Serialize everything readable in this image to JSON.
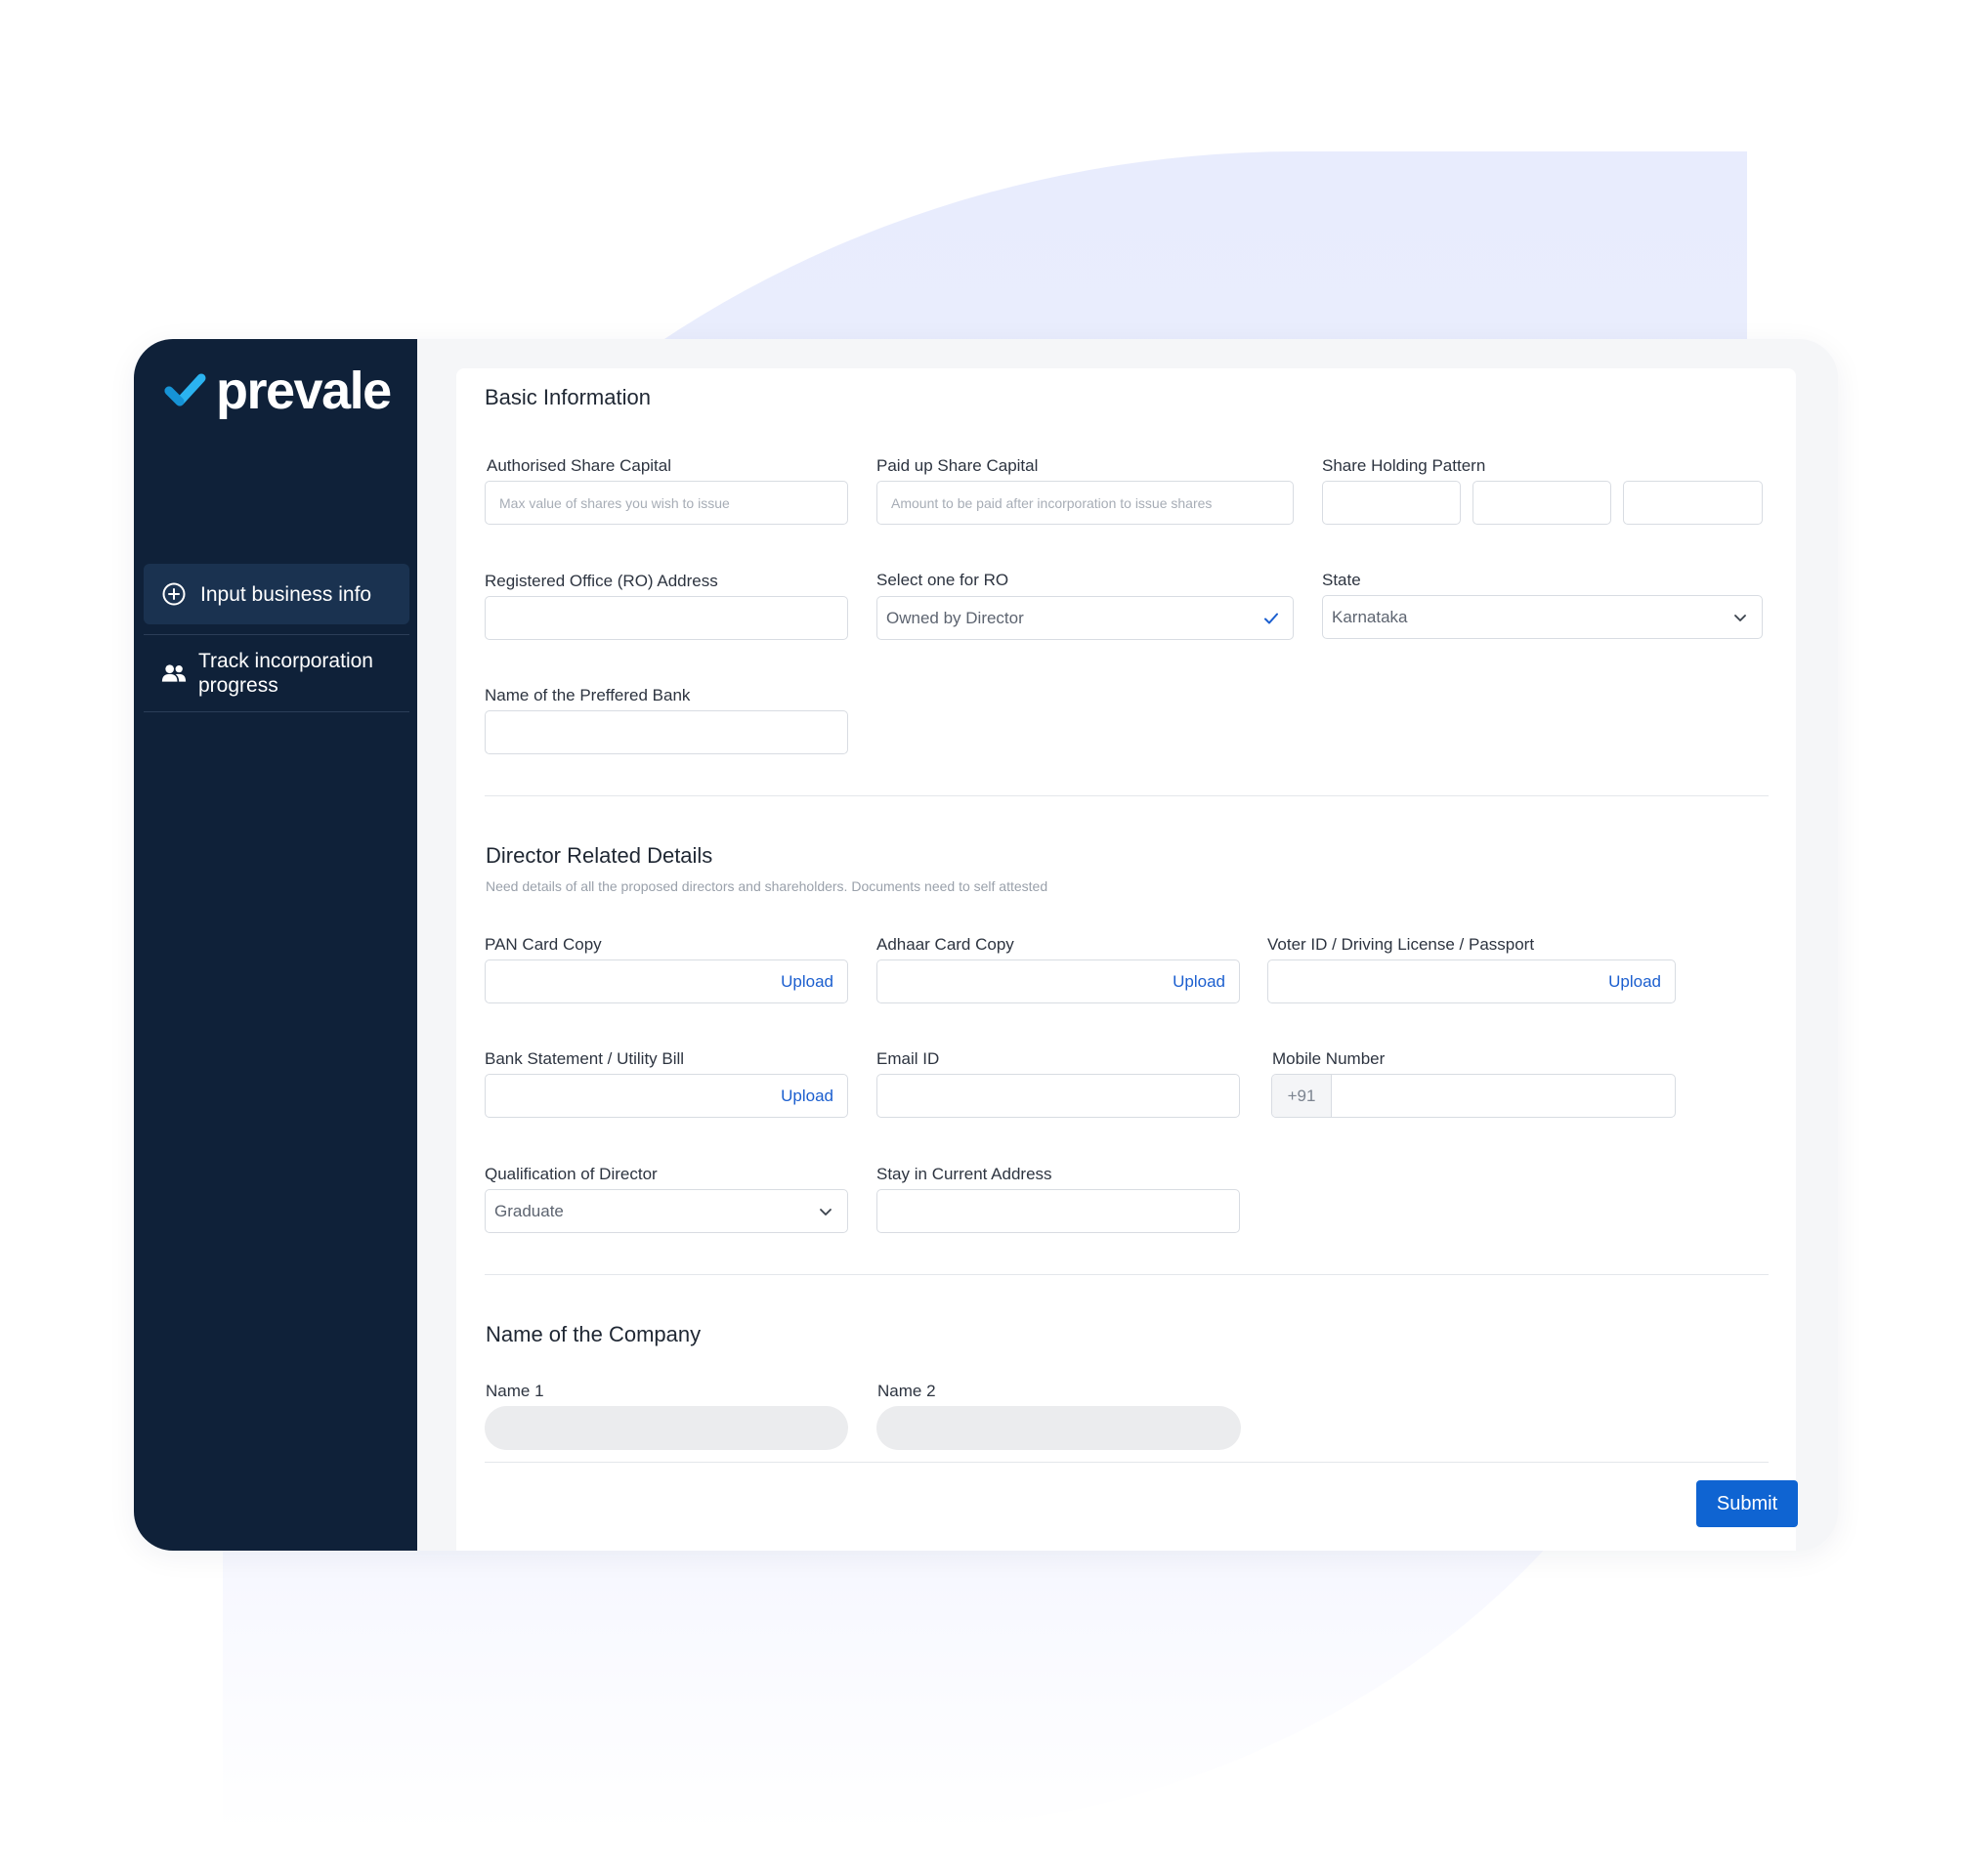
{
  "brand": {
    "name": "prevale"
  },
  "sidebar": {
    "items": [
      {
        "label": "Input business info",
        "icon": "plus-circle-icon",
        "active": true
      },
      {
        "label": "Track incorporation progress",
        "icon": "users-icon",
        "active": false
      }
    ]
  },
  "basic_info": {
    "title": "Basic Information",
    "authorised_share_capital": {
      "label": "Authorised Share Capital",
      "placeholder": "Max value of shares you wish to issue"
    },
    "paid_up_share_capital": {
      "label": "Paid up Share Capital",
      "placeholder": "Amount to be paid after incorporation to issue shares"
    },
    "share_holding_pattern": {
      "label": "Share Holding Pattern"
    },
    "ro_address": {
      "label": "Registered Office (RO) Address"
    },
    "select_ro": {
      "label": "Select one for RO",
      "value": "Owned by Director"
    },
    "state": {
      "label": "State",
      "value": "Karnataka"
    },
    "preferred_bank": {
      "label": "Name of the Preffered Bank"
    }
  },
  "director": {
    "title": "Director Related Details",
    "subtitle": "Need details of all the proposed directors and shareholders. Documents need to self attested",
    "pan": {
      "label": "PAN Card Copy",
      "action": "Upload"
    },
    "aadhaar": {
      "label": "Adhaar Card Copy",
      "action": "Upload"
    },
    "voter": {
      "label": "Voter ID / Driving License / Passport",
      "action": "Upload"
    },
    "bank_statement": {
      "label": "Bank Statement / Utility Bill",
      "action": "Upload"
    },
    "email": {
      "label": "Email ID"
    },
    "mobile": {
      "label": "Mobile Number",
      "prefix": "+91"
    },
    "qualification": {
      "label": "Qualification of Director",
      "value": "Graduate"
    },
    "stay": {
      "label": "Stay in Current Address"
    }
  },
  "company": {
    "title": "Name of the Company",
    "name1": {
      "label": "Name 1"
    },
    "name2": {
      "label": "Name 2"
    }
  },
  "actions": {
    "submit_label": "Submit"
  },
  "colors": {
    "sidebar_bg": "#0f2139",
    "sidebar_active": "#1a3250",
    "accent": "#0f64d2",
    "link": "#1c5fcf",
    "logo_check": "#2bb3f0"
  }
}
